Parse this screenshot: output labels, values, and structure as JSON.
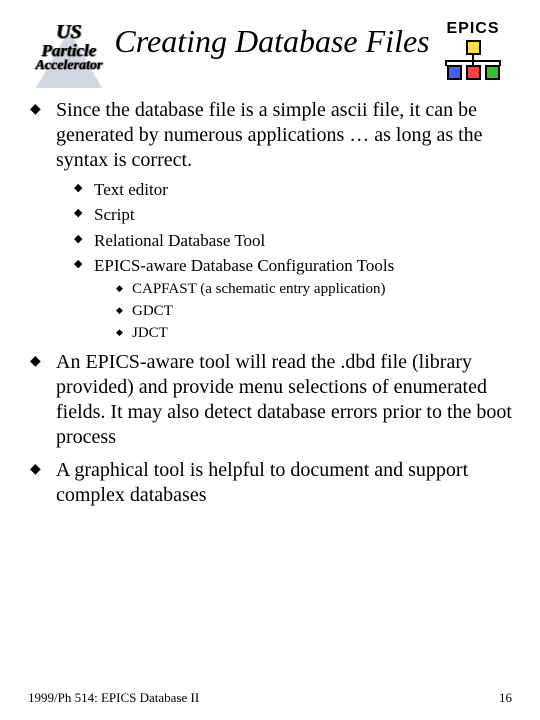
{
  "header": {
    "left_logo": {
      "line1": "US",
      "line2": "Particle",
      "line3": "Accelerator"
    },
    "title": "Creating Database Files",
    "right_logo_text": "EPICS"
  },
  "bullets": [
    {
      "text": "Since the database file is a simple ascii file, it can be generated by numerous applications … as long as the syntax is correct.",
      "children": [
        {
          "text": "Text editor"
        },
        {
          "text": "Script"
        },
        {
          "text": "Relational Database Tool"
        },
        {
          "text": "EPICS-aware Database Configuration Tools",
          "children": [
            {
              "text": "CAPFAST (a schematic entry application)"
            },
            {
              "text": "GDCT"
            },
            {
              "text": "JDCT"
            }
          ]
        }
      ]
    },
    {
      "text": "An EPICS-aware tool will read the .dbd file (library provided) and provide menu selections of enumerated fields. It may also detect database errors prior to the boot process"
    },
    {
      "text": "A graphical tool is helpful to document and support complex databases"
    }
  ],
  "footer": {
    "left": "1999/Ph 514: EPICS Database II",
    "right": "16"
  }
}
